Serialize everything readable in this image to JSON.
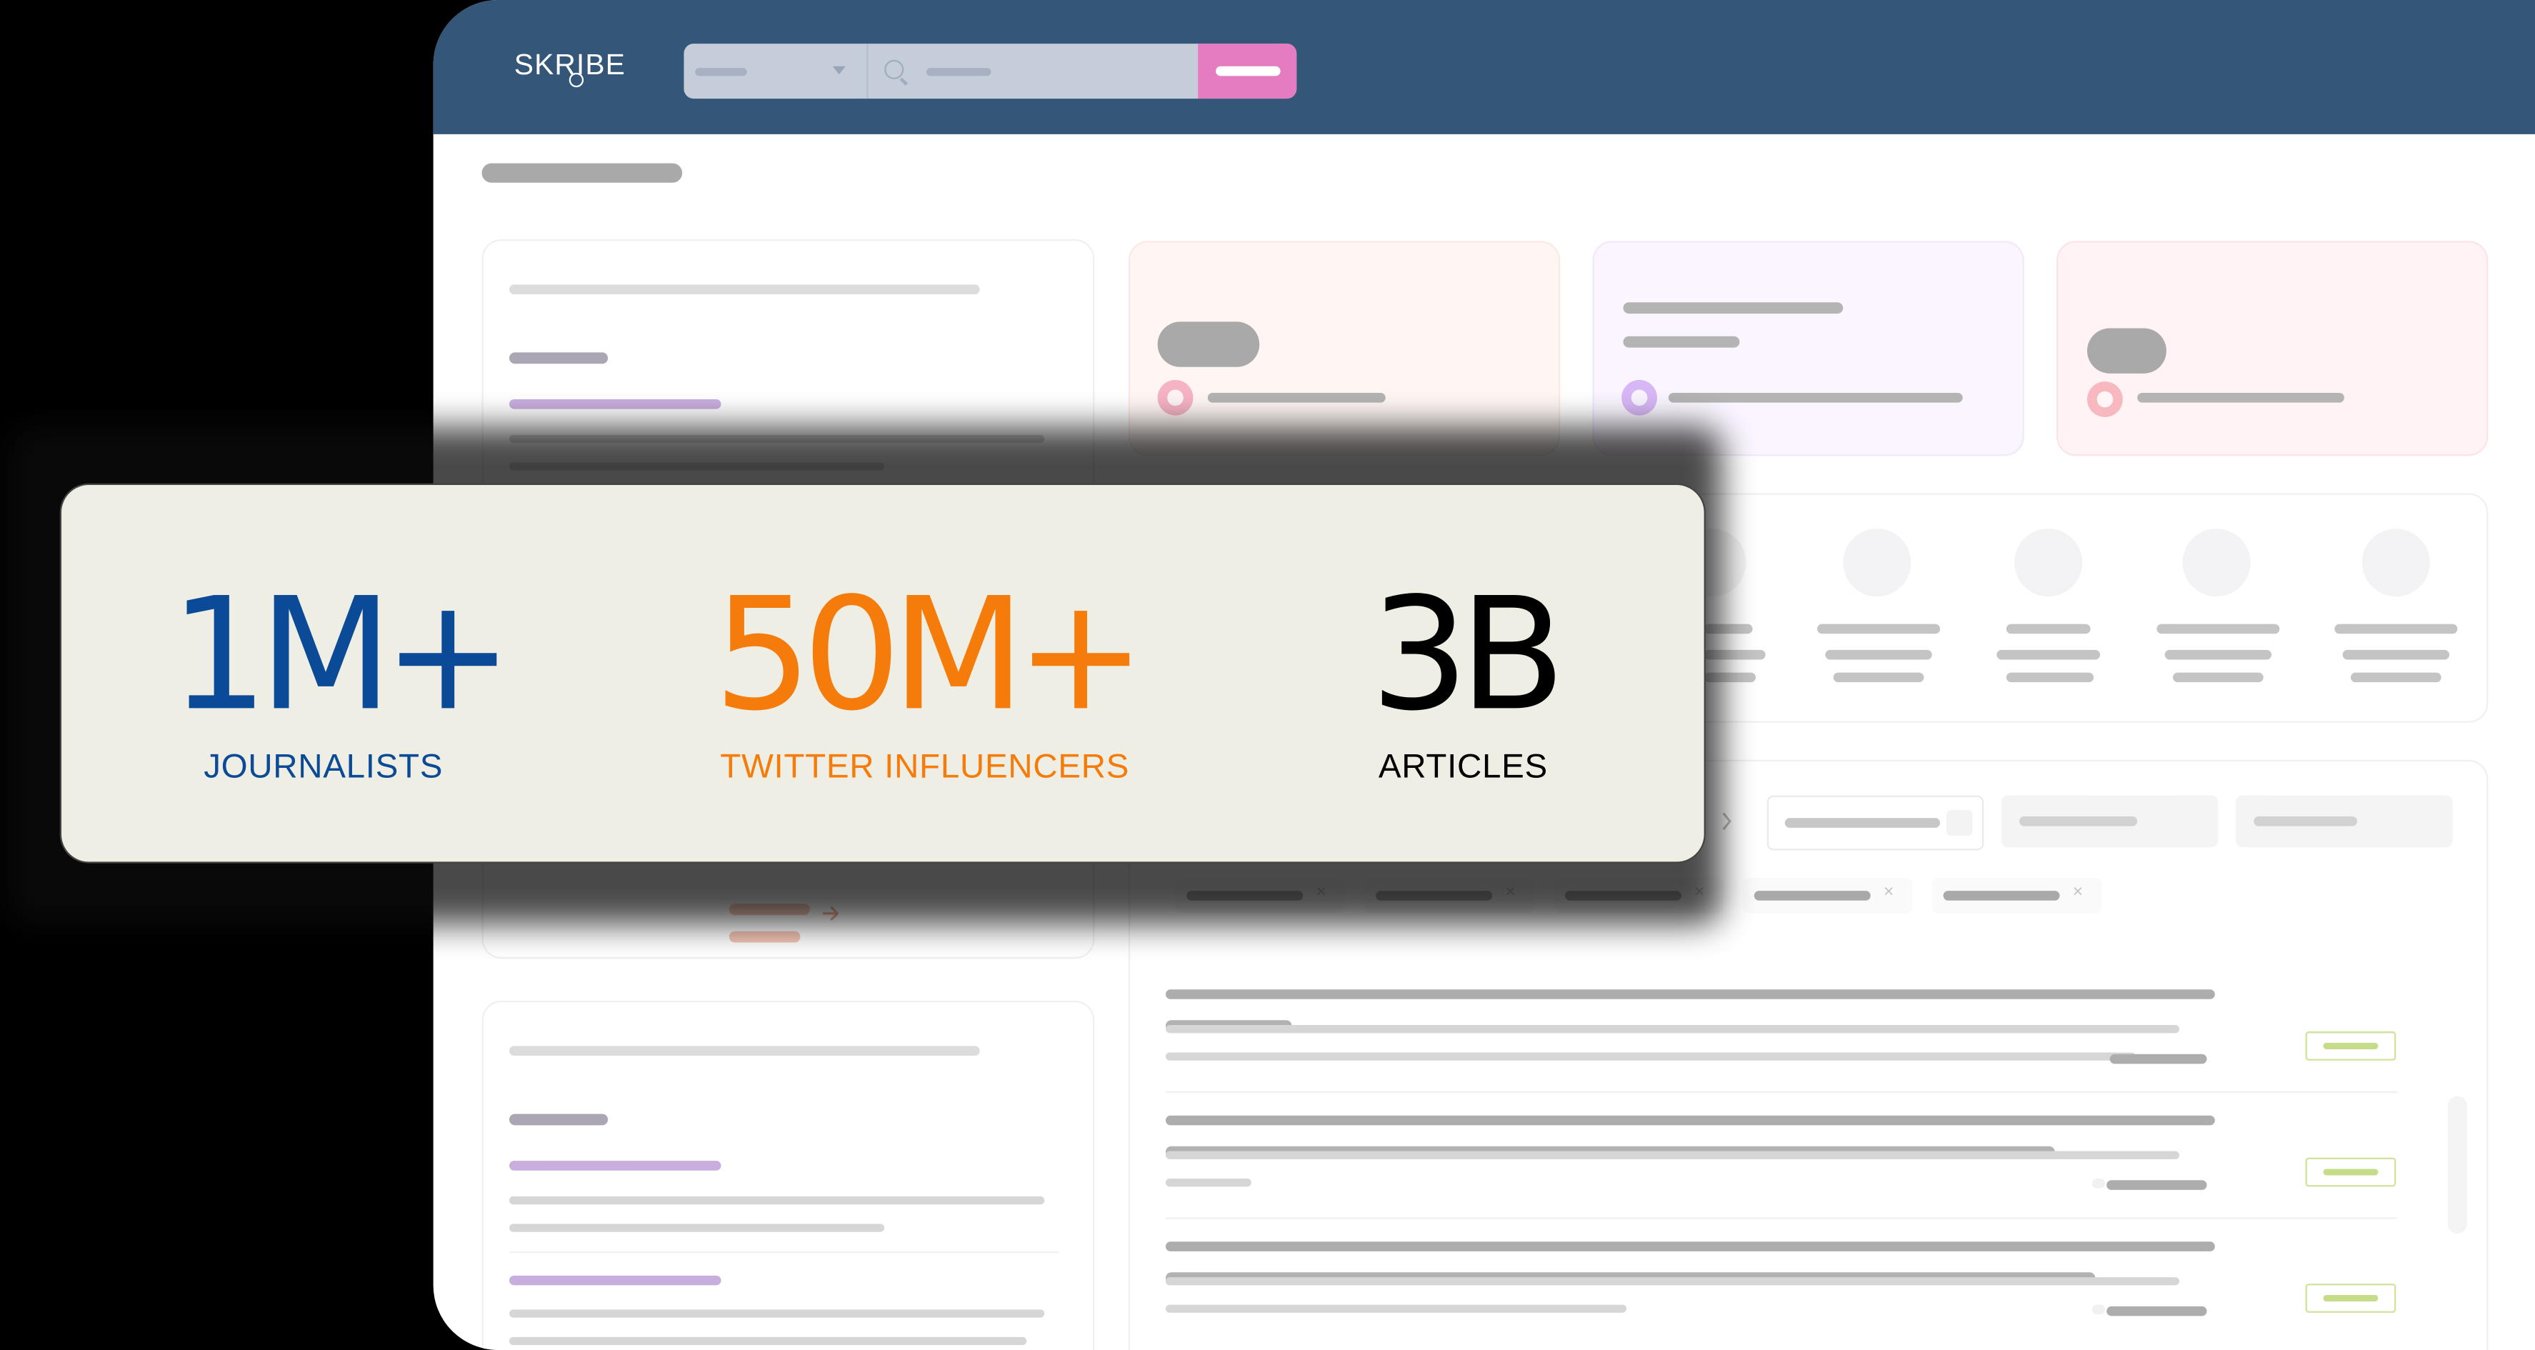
{
  "app": {
    "logo_text": "SKRIBE"
  },
  "stats": [
    {
      "value": "1M+",
      "label": "JOURNALISTS",
      "color": "#0b4a96"
    },
    {
      "value": "50M+",
      "label": "TWITTER INFLUENCERS",
      "color": "#f57c0a"
    },
    {
      "value": "3B",
      "label": "ARTICLES",
      "color": "#000000"
    }
  ],
  "colors": {
    "header": "#335679",
    "search_button": "#e57bc0",
    "banner_background": "#efeee4",
    "backdrop": "#000000"
  },
  "icons": [
    "search-icon",
    "chevron-down-icon",
    "user-icon",
    "clock-icon",
    "megaphone-icon",
    "close-icon",
    "arrow-right-icon",
    "chevron-right-icon"
  ]
}
